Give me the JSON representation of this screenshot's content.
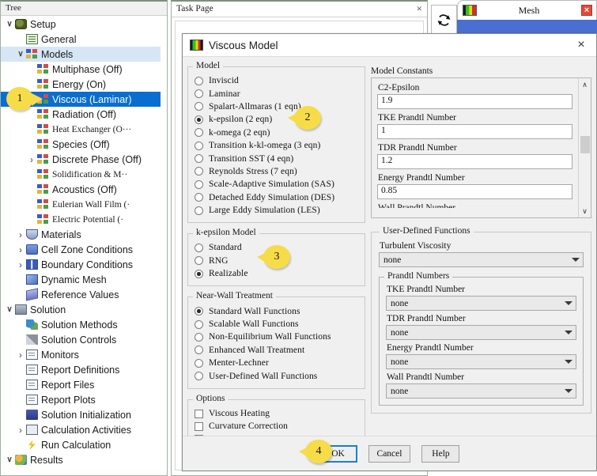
{
  "tree": {
    "header": "Tree",
    "items": [
      {
        "label": "Setup",
        "indent": 0,
        "twisty": "down",
        "icon": "ic-setup",
        "state": "normal",
        "serif": false
      },
      {
        "label": "General",
        "indent": 1,
        "twisty": "none",
        "icon": "ic-general",
        "state": "normal",
        "serif": false
      },
      {
        "label": "Models",
        "indent": 1,
        "twisty": "down",
        "icon": "ic-models",
        "state": "highlight",
        "serif": false
      },
      {
        "label": "Multiphase (Off)",
        "indent": 2,
        "twisty": "none",
        "icon": "ic-models",
        "state": "normal",
        "serif": false
      },
      {
        "label": "Energy (On)",
        "indent": 2,
        "twisty": "none",
        "icon": "ic-models",
        "state": "normal",
        "serif": false
      },
      {
        "label": "Viscous (Laminar)",
        "indent": 2,
        "twisty": "none",
        "icon": "ic-models",
        "state": "selected",
        "serif": false
      },
      {
        "label": "Radiation (Off)",
        "indent": 2,
        "twisty": "none",
        "icon": "ic-models",
        "state": "normal",
        "serif": false
      },
      {
        "label": "Heat Exchanger (O···",
        "indent": 2,
        "twisty": "none",
        "icon": "ic-models",
        "state": "normal",
        "serif": true
      },
      {
        "label": "Species (Off)",
        "indent": 2,
        "twisty": "none",
        "icon": "ic-models",
        "state": "normal",
        "serif": false
      },
      {
        "label": "Discrete Phase (Off)",
        "indent": 2,
        "twisty": "right",
        "icon": "ic-models",
        "state": "normal",
        "serif": false
      },
      {
        "label": "Solidification & M··",
        "indent": 2,
        "twisty": "none",
        "icon": "ic-models",
        "state": "normal",
        "serif": true
      },
      {
        "label": "Acoustics (Off)",
        "indent": 2,
        "twisty": "none",
        "icon": "ic-models",
        "state": "normal",
        "serif": false
      },
      {
        "label": "Eulerian Wall Film (·",
        "indent": 2,
        "twisty": "none",
        "icon": "ic-models",
        "state": "normal",
        "serif": true
      },
      {
        "label": "Electric Potential (·",
        "indent": 2,
        "twisty": "none",
        "icon": "ic-models",
        "state": "normal",
        "serif": true
      },
      {
        "label": "Materials",
        "indent": 1,
        "twisty": "right",
        "icon": "ic-materials",
        "state": "normal",
        "serif": false
      },
      {
        "label": "Cell Zone Conditions",
        "indent": 1,
        "twisty": "right",
        "icon": "ic-cellzone",
        "state": "normal",
        "serif": false
      },
      {
        "label": "Boundary Conditions",
        "indent": 1,
        "twisty": "right",
        "icon": "ic-boundary",
        "state": "normal",
        "serif": false
      },
      {
        "label": "Dynamic Mesh",
        "indent": 1,
        "twisty": "none",
        "icon": "ic-dynmesh",
        "state": "normal",
        "serif": false
      },
      {
        "label": "Reference Values",
        "indent": 1,
        "twisty": "none",
        "icon": "ic-refvals",
        "state": "normal",
        "serif": false
      },
      {
        "label": "Solution",
        "indent": 0,
        "twisty": "down",
        "icon": "ic-solution",
        "state": "normal",
        "serif": false
      },
      {
        "label": "Solution Methods",
        "indent": 1,
        "twisty": "none",
        "icon": "ic-solmethods",
        "state": "normal",
        "serif": false
      },
      {
        "label": "Solution Controls",
        "indent": 1,
        "twisty": "none",
        "icon": "ic-solctrl",
        "state": "normal",
        "serif": false
      },
      {
        "label": "Monitors",
        "indent": 1,
        "twisty": "right",
        "icon": "ic-report",
        "state": "normal",
        "serif": false
      },
      {
        "label": "Report Definitions",
        "indent": 1,
        "twisty": "none",
        "icon": "ic-report",
        "state": "normal",
        "serif": false
      },
      {
        "label": "Report Files",
        "indent": 1,
        "twisty": "none",
        "icon": "ic-report",
        "state": "normal",
        "serif": false
      },
      {
        "label": "Report Plots",
        "indent": 1,
        "twisty": "none",
        "icon": "ic-report",
        "state": "normal",
        "serif": false
      },
      {
        "label": "Solution Initialization",
        "indent": 1,
        "twisty": "none",
        "icon": "ic-init",
        "state": "normal",
        "serif": false
      },
      {
        "label": "Calculation Activities",
        "indent": 1,
        "twisty": "right",
        "icon": "ic-calcact",
        "state": "normal",
        "serif": false
      },
      {
        "label": "Run Calculation",
        "indent": 1,
        "twisty": "none",
        "icon": "ic-run",
        "state": "normal",
        "serif": false
      },
      {
        "label": "Results",
        "indent": 0,
        "twisty": "down",
        "icon": "ic-results",
        "state": "normal",
        "serif": false
      }
    ]
  },
  "task_page": {
    "title": "Task Page",
    "close_label": "×"
  },
  "graphics": {
    "tab_label": "Mesh",
    "close_label": "×",
    "refresh_icon": "refresh-icon"
  },
  "dialog": {
    "title": "Viscous Model",
    "close_label": "×",
    "model_group": {
      "title": "Model",
      "options": [
        {
          "label": "Inviscid",
          "selected": false
        },
        {
          "label": "Laminar",
          "selected": false
        },
        {
          "label": "Spalart-Allmaras (1 eqn)",
          "selected": false
        },
        {
          "label": "k-epsilon (2 eqn)",
          "selected": true
        },
        {
          "label": "k-omega (2 eqn)",
          "selected": false
        },
        {
          "label": "Transition k-kl-omega (3 eqn)",
          "selected": false
        },
        {
          "label": "Transition SST (4 eqn)",
          "selected": false
        },
        {
          "label": "Reynolds Stress (7 eqn)",
          "selected": false
        },
        {
          "label": "Scale-Adaptive Simulation (SAS)",
          "selected": false
        },
        {
          "label": "Detached Eddy Simulation (DES)",
          "selected": false
        },
        {
          "label": "Large Eddy Simulation (LES)",
          "selected": false
        }
      ]
    },
    "kepsilon_group": {
      "title": "k-epsilon Model",
      "options": [
        {
          "label": "Standard",
          "selected": false
        },
        {
          "label": "RNG",
          "selected": false
        },
        {
          "label": "Realizable",
          "selected": true
        }
      ]
    },
    "nearwall_group": {
      "title": "Near-Wall Treatment",
      "options": [
        {
          "label": "Standard Wall Functions",
          "selected": true
        },
        {
          "label": "Scalable Wall Functions",
          "selected": false
        },
        {
          "label": "Non-Equilibrium Wall Functions",
          "selected": false
        },
        {
          "label": "Enhanced Wall Treatment",
          "selected": false
        },
        {
          "label": "Menter-Lechner",
          "selected": false
        },
        {
          "label": "User-Defined Wall Functions",
          "selected": false
        }
      ]
    },
    "options_group": {
      "title": "Options",
      "checkboxes": [
        {
          "label": "Viscous Heating",
          "checked": false
        },
        {
          "label": "Curvature Correction",
          "checked": false
        },
        {
          "label": "Production Limiter",
          "checked": false
        }
      ]
    },
    "model_constants": {
      "title": "Model Constants",
      "fields": [
        {
          "label": "C2-Epsilon",
          "value": "1.9"
        },
        {
          "label": "TKE Prandtl Number",
          "value": "1"
        },
        {
          "label": "TDR Prandtl Number",
          "value": "1.2"
        },
        {
          "label": "Energy Prandtl Number",
          "value": "0.85"
        }
      ],
      "clipped_label": "Wall Prandtl Number",
      "scroll_up": "∧",
      "scroll_down": "∨"
    },
    "udf": {
      "title": "User-Defined Functions",
      "turbulent_viscosity": {
        "label": "Turbulent Viscosity",
        "value": "none"
      },
      "prandtl_numbers": {
        "title": "Prandtl Numbers",
        "fields": [
          {
            "label": "TKE Prandtl Number",
            "value": "none"
          },
          {
            "label": "TDR Prandtl Number",
            "value": "none"
          },
          {
            "label": "Energy Prandtl Number",
            "value": "none"
          },
          {
            "label": "Wall Prandtl Number",
            "value": "none"
          }
        ]
      }
    },
    "footer": {
      "ok": "OK",
      "cancel": "Cancel",
      "help": "Help"
    }
  },
  "callouts": [
    {
      "num": "1",
      "dir": "left"
    },
    {
      "num": "2",
      "dir": "right"
    },
    {
      "num": "3",
      "dir": "right"
    },
    {
      "num": "4",
      "dir": "right"
    }
  ],
  "colors": {
    "selection_blue": "#0a6ed1",
    "callout_yellow": "#f7dc4a",
    "dialog_bg": "#f0f0f0",
    "focus_blue": "#1a7fd4",
    "mesh_blue": "#4a6fd0",
    "close_red": "#e24a3c"
  }
}
